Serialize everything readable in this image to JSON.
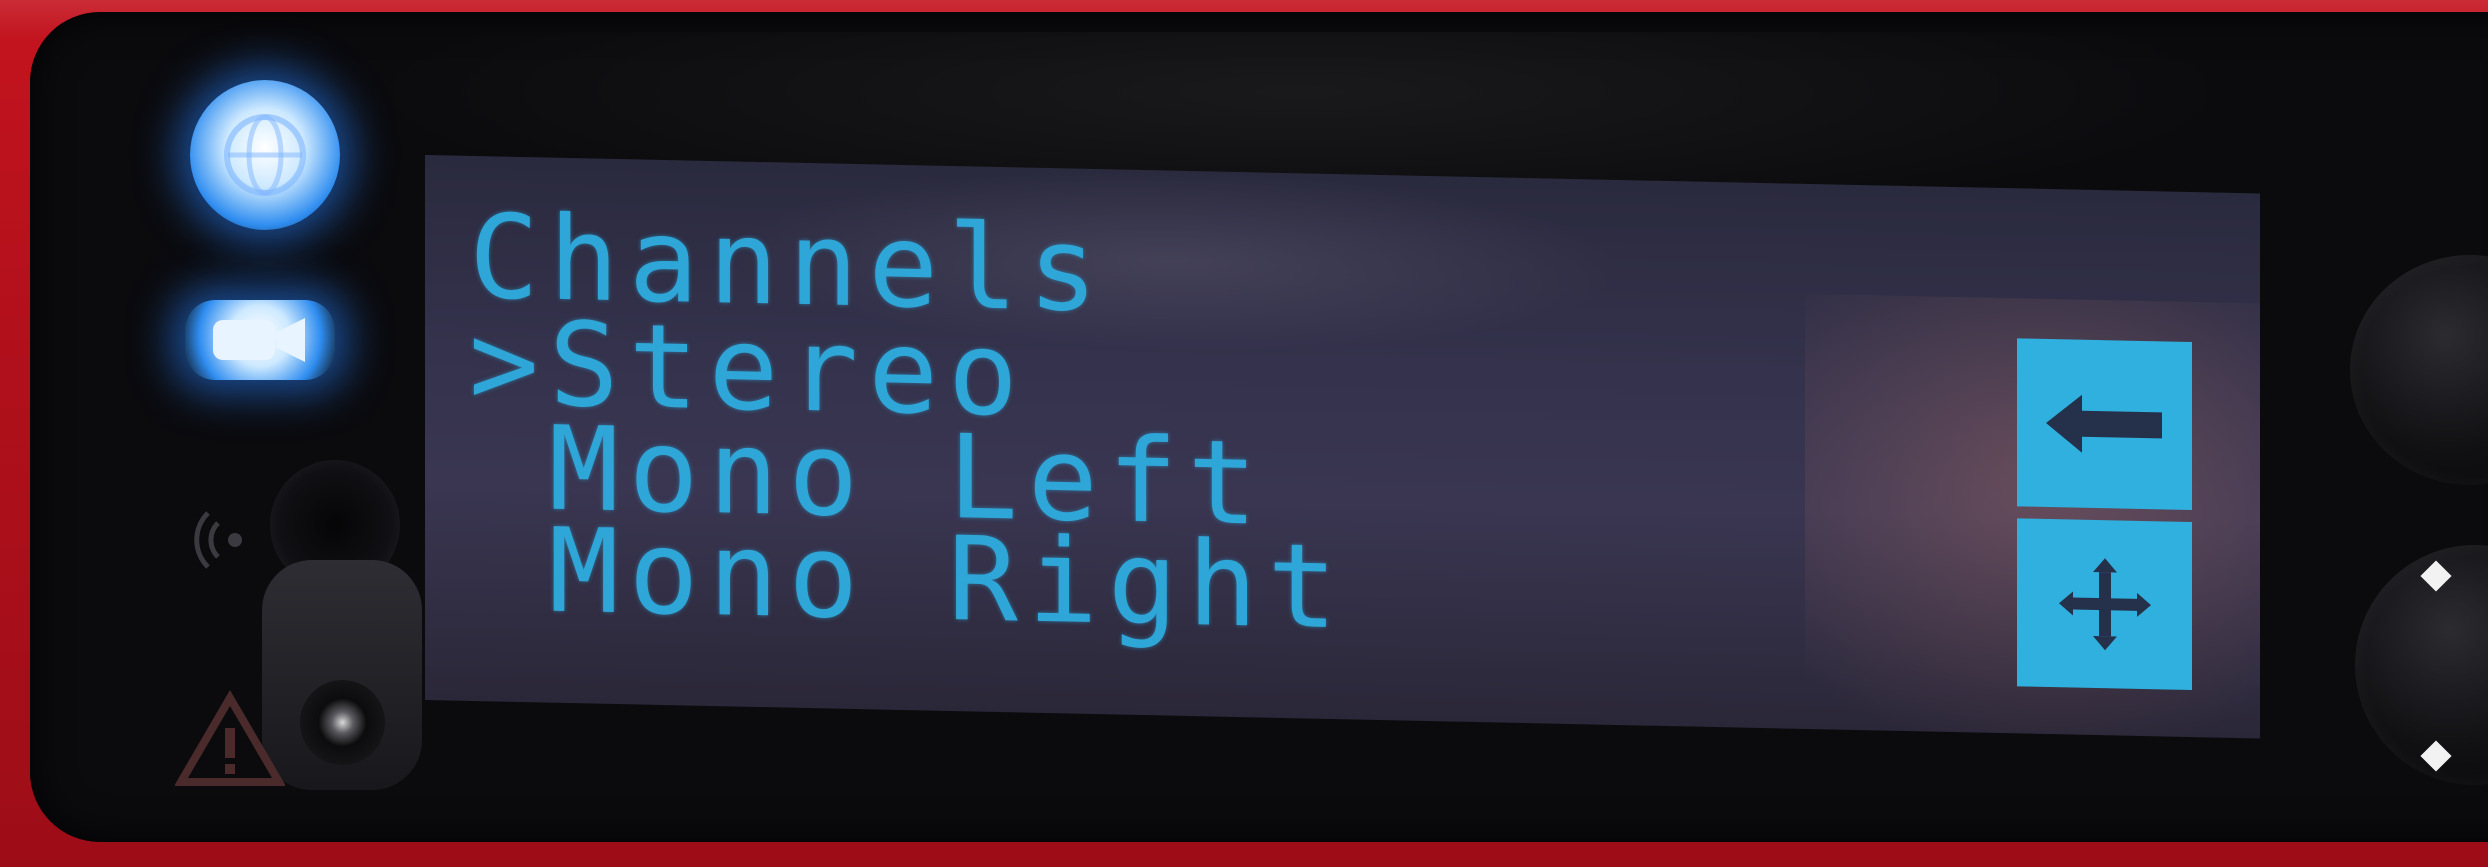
{
  "screen": {
    "menu": {
      "title": "Channels",
      "cursor": ">",
      "items": [
        {
          "label": "Stereo",
          "selected": true
        },
        {
          "label": "Mono Left",
          "selected": false
        },
        {
          "label": "Mono Right",
          "selected": false
        }
      ]
    },
    "soft_buttons": [
      {
        "icon": "back-arrow-icon"
      },
      {
        "icon": "move-cross-icon"
      }
    ]
  },
  "indicators": [
    {
      "icon": "globe-icon",
      "state": "on"
    },
    {
      "icon": "video-camera-icon",
      "state": "on"
    }
  ],
  "colors": {
    "lcd_text": "#2ea6d8",
    "lcd_background": "#34324c",
    "soft_button": "#2fb0de",
    "led_blue": "#2f8df0",
    "device_body": "#b1101b",
    "bezel": "#0b0b0e"
  }
}
